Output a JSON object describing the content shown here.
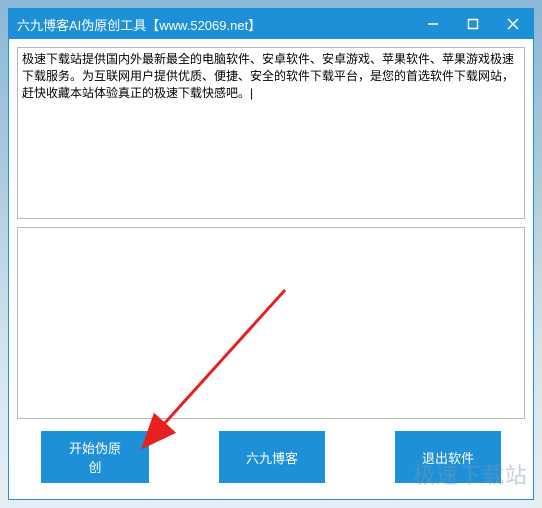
{
  "window": {
    "title": "六九博客AI伪原创工具【www.52069.net】"
  },
  "input_text": "极速下载站提供国内外最新最全的电脑软件、安卓软件、安卓游戏、苹果软件、苹果游戏极速下载服务。为互联网用户提供优质、便捷、安全的软件下载平台，是您的首选软件下载网站，赶快收藏本站体验真正的极速下载快感吧。|",
  "output_text": "",
  "buttons": {
    "start": "开始伪原创",
    "blog": "六九博客",
    "exit": "退出软件"
  },
  "watermark": "极速下载站"
}
